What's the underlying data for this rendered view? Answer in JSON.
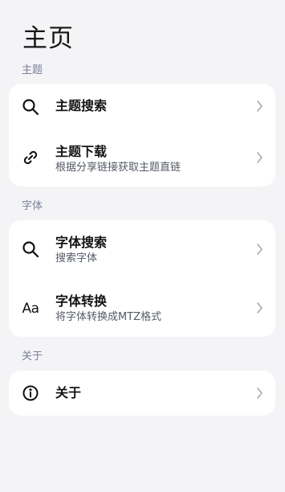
{
  "page": {
    "title": "主页"
  },
  "sections": {
    "theme": {
      "title": "主题",
      "items": [
        {
          "label": "主题搜索",
          "sub": "",
          "icon": "search-icon"
        },
        {
          "label": "主题下载",
          "sub": "根据分享链接获取主题直链",
          "icon": "link-icon"
        }
      ]
    },
    "font": {
      "title": "字体",
      "items": [
        {
          "label": "字体搜索",
          "sub": "搜索字体",
          "icon": "search-icon"
        },
        {
          "label": "字体转换",
          "sub": "将字体转换成MTZ格式",
          "icon": "font-aa-icon",
          "icon_text": "Aa"
        }
      ]
    },
    "about": {
      "title": "关于",
      "items": [
        {
          "label": "关于",
          "sub": "",
          "icon": "info-icon"
        }
      ]
    }
  },
  "colors": {
    "background": "#f4f4f6",
    "card": "#ffffff",
    "section_title": "#7a7e9a",
    "chevron": "#a8a8ad"
  }
}
